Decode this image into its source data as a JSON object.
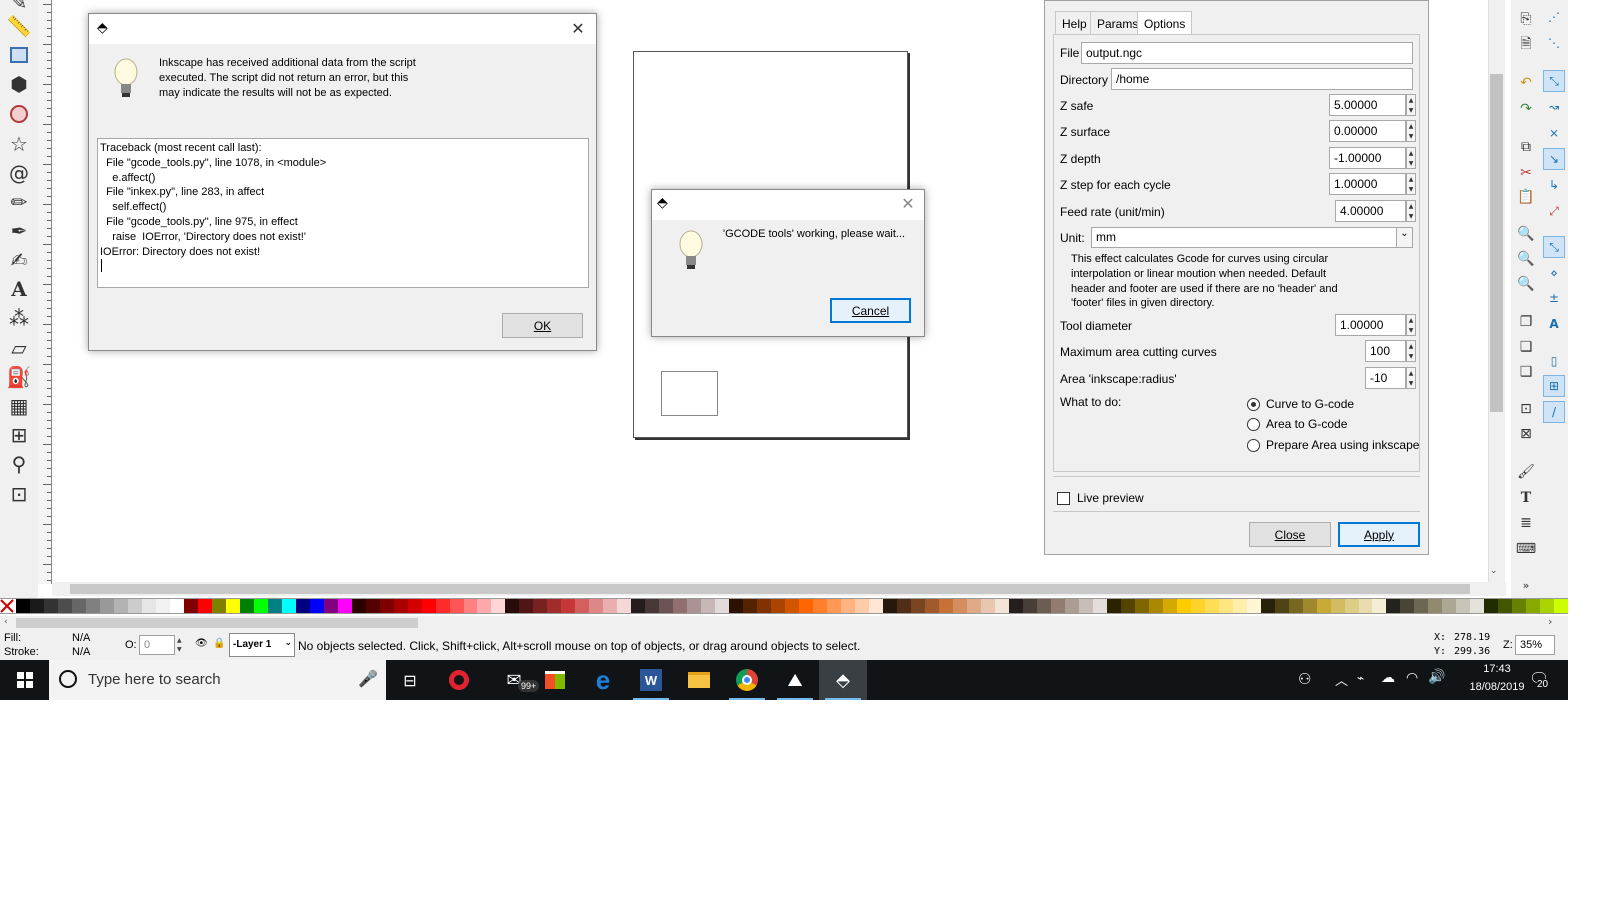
{
  "error_dialog": {
    "message": "Inkscape has received additional data from the script executed.  The script did not return an error, but this may indicate the results will not be as expected.",
    "traceback": [
      "Traceback (most recent call last):",
      "  File \"gcode_tools.py\", line 1078, in <module>",
      "    e.affect()",
      "  File \"inkex.py\", line 283, in affect",
      "    self.effect()",
      "  File \"gcode_tools.py\", line 975, in effect",
      "    raise  IOError, 'Directory does not exist!'",
      "IOError: Directory does not exist!"
    ],
    "ok_label": "OK"
  },
  "working_dialog": {
    "message": "'GCODE tools' working, please wait...",
    "cancel_label": "Cancel"
  },
  "panel": {
    "tabs": [
      "Help",
      "Params",
      "Options"
    ],
    "active_tab": "Options",
    "file_label": "File",
    "file_value": "output.ngc",
    "directory_label": "Directory",
    "directory_value": "/home",
    "fields": [
      {
        "label": "Z safe",
        "value": "5.00000"
      },
      {
        "label": "Z surface",
        "value": "0.00000"
      },
      {
        "label": "Z depth",
        "value": "-1.00000"
      },
      {
        "label": "Z step for each cycle",
        "value": "1.00000"
      },
      {
        "label": "Feed rate (unit/min)",
        "value": "4.00000"
      }
    ],
    "unit_label": "Unit:",
    "unit_value": "mm",
    "description": "This effect calculates Gcode for curves using circular interpolation or linear moution when needed. Default header and footer are used if there are no 'header' and 'footer' files in given directory.",
    "fields2": [
      {
        "label": "Tool diameter",
        "value": "1.00000"
      },
      {
        "label": "Maximum area cutting curves",
        "value": "100"
      },
      {
        "label": "Area 'inkscape:radius'",
        "value": "-10"
      }
    ],
    "what_label": "What to do:",
    "options": [
      "Curve to G-code",
      "Area to G-code",
      "Prepare Area using inkscape"
    ],
    "selected_option": 0,
    "live_preview_label": "Live preview",
    "close_label": "Close",
    "apply_label": "Apply"
  },
  "statusbar": {
    "fill_label": "Fill:",
    "fill_value": "N/A",
    "stroke_label": "Stroke:",
    "stroke_value": "N/A",
    "opacity_label": "O:",
    "opacity_value": "0",
    "layer_label": "-Layer 1",
    "message": "No objects selected. Click, Shift+click, Alt+scroll mouse on top of objects, or drag around objects to select.",
    "x_label": "X:",
    "x_value": "278.19",
    "y_label": "Y:",
    "y_value": "299.36",
    "zoom_label": "Z:",
    "zoom_value": "35%"
  },
  "taskbar": {
    "search_placeholder": "Type here to search",
    "mail_badge": "99+",
    "time": "17:43",
    "date": "18/08/2019",
    "notifications": "20"
  }
}
